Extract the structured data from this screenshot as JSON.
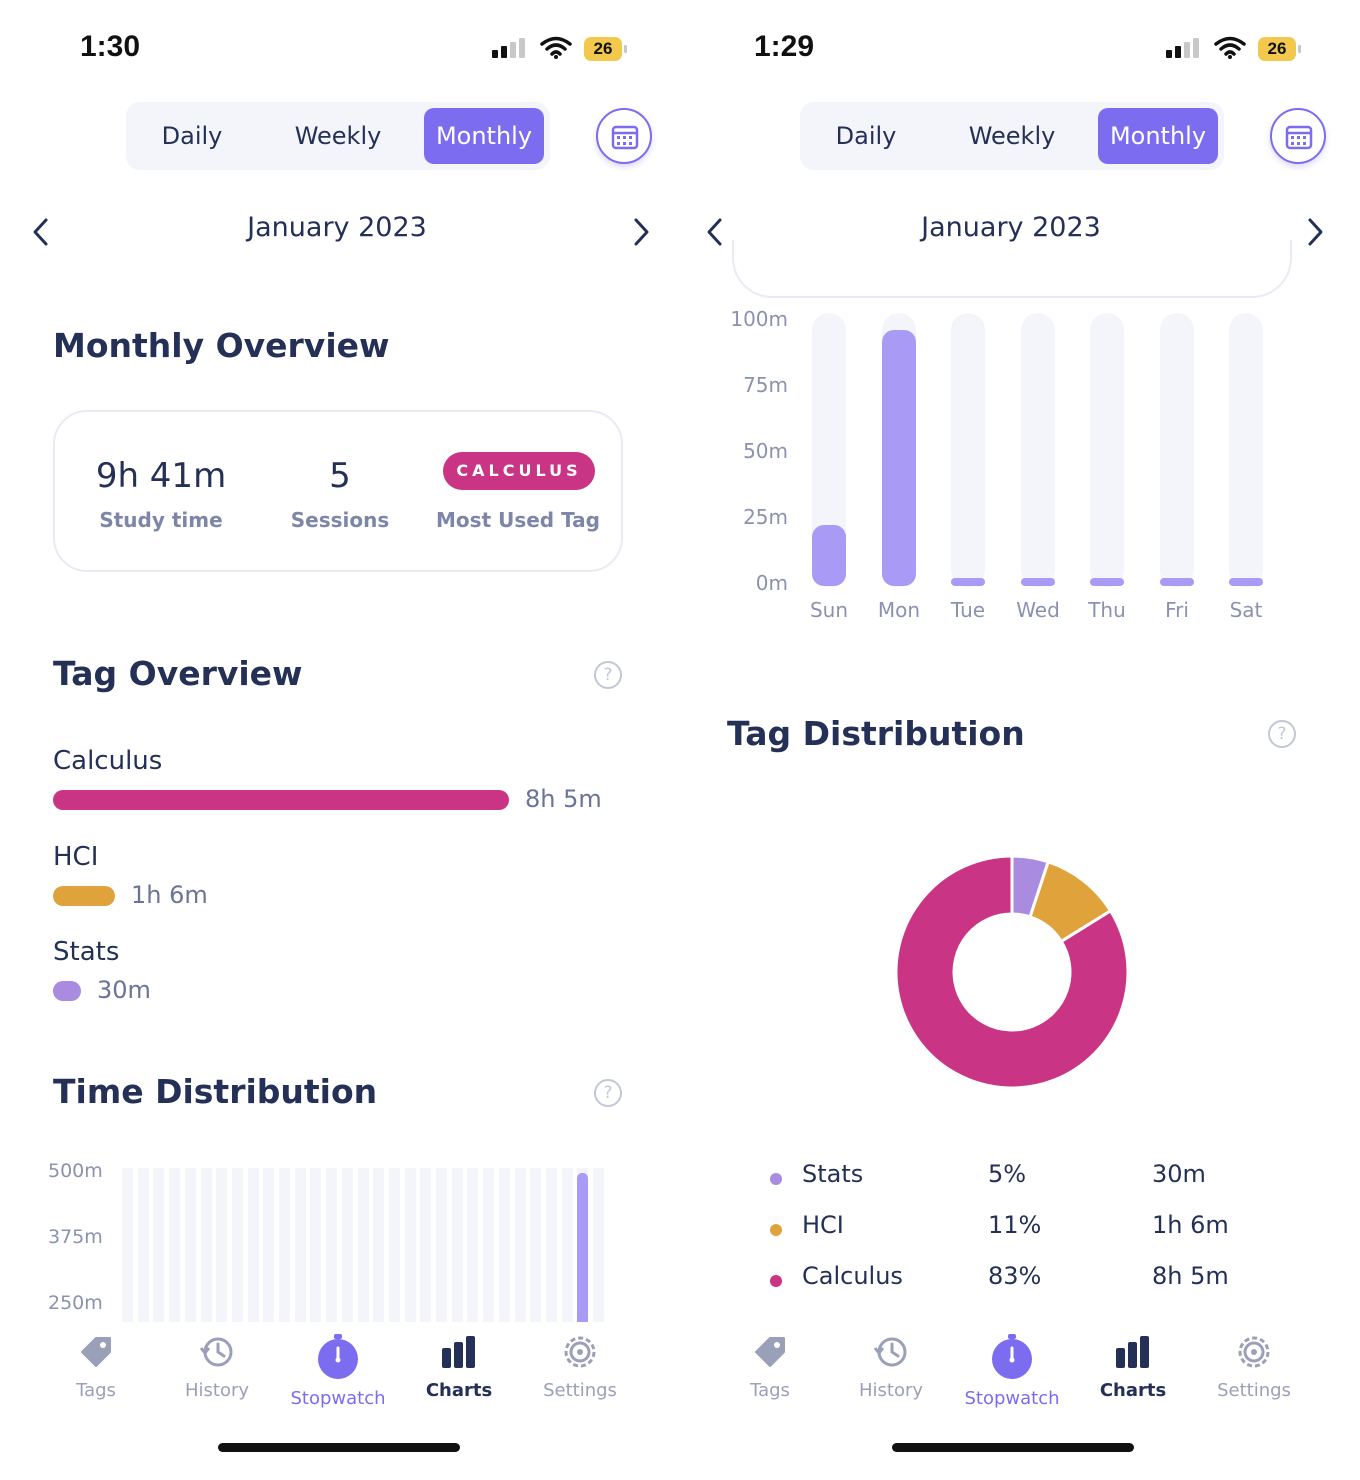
{
  "colors": {
    "accent": "#7b6cf0",
    "calculus": "#c93584",
    "hci": "#e0a23a",
    "stats": "#a98be0",
    "bar": "#a89af5",
    "track": "#f3f5fb",
    "text": "#243056"
  },
  "screens": [
    {
      "status": {
        "time": "1:30",
        "battery": "26"
      },
      "segments": [
        "Daily",
        "Weekly",
        "Monthly"
      ],
      "active_segment": "Monthly",
      "month": "January 2023",
      "monthly_overview": {
        "title": "Monthly Overview",
        "study_time_value": "9h 41m",
        "study_time_label": "Study time",
        "sessions_value": "5",
        "sessions_label": "Sessions",
        "top_tag": "CALCULUS",
        "top_tag_label": "Most Used Tag"
      },
      "tag_overview": {
        "title": "Tag Overview",
        "tags": [
          {
            "name": "Calculus",
            "duration": "8h 5m",
            "fraction": 1.0,
            "color": "#c93584"
          },
          {
            "name": "HCI",
            "duration": "1h 6m",
            "fraction": 0.136,
            "color": "#e0a23a"
          },
          {
            "name": "Stats",
            "duration": "30m",
            "fraction": 0.062,
            "color": "#a98be0"
          }
        ]
      },
      "time_distribution": {
        "title": "Time Distribution",
        "y_ticks": [
          "500m",
          "375m",
          "250m"
        ],
        "days_shown": 31,
        "highlight_day_index": 29,
        "highlight_value_m": 485
      }
    },
    {
      "status": {
        "time": "1:29",
        "battery": "26"
      },
      "segments": [
        "Daily",
        "Weekly",
        "Monthly"
      ],
      "active_segment": "Monthly",
      "month": "January 2023",
      "weekly_chart": {
        "y_ticks": [
          "100m",
          "75m",
          "50m",
          "25m",
          "0m"
        ],
        "days": [
          "Sun",
          "Mon",
          "Tue",
          "Wed",
          "Thu",
          "Fri",
          "Sat"
        ],
        "values_m": [
          23,
          97,
          0,
          0,
          0,
          0,
          0
        ]
      },
      "tag_distribution": {
        "title": "Tag Distribution",
        "items": [
          {
            "name": "Stats",
            "percent": "5%",
            "duration": "30m",
            "value": 5,
            "color": "#a98be0"
          },
          {
            "name": "HCI",
            "percent": "11%",
            "duration": "1h 6m",
            "value": 11,
            "color": "#e0a23a"
          },
          {
            "name": "Calculus",
            "percent": "83%",
            "duration": "8h 5m",
            "value": 83,
            "color": "#c93584"
          }
        ]
      }
    }
  ],
  "tabbar": {
    "items": [
      {
        "label": "Tags",
        "icon": "tag-icon"
      },
      {
        "label": "History",
        "icon": "history-icon"
      },
      {
        "label": "Stopwatch",
        "icon": "stopwatch-icon"
      },
      {
        "label": "Charts",
        "icon": "bar-chart-icon"
      },
      {
        "label": "Settings",
        "icon": "gear-icon"
      }
    ]
  }
}
